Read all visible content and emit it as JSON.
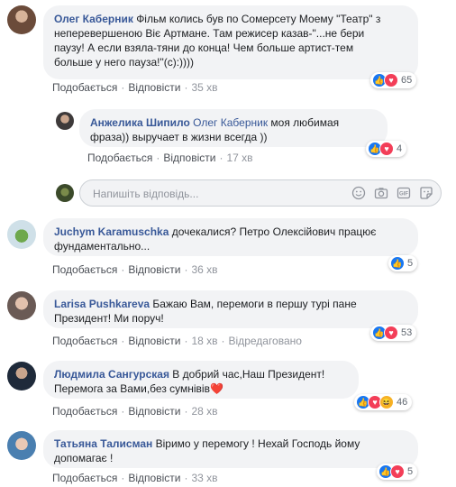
{
  "labels": {
    "like": "Подобається",
    "reply": "Відповісти",
    "edited": "Відредаговано",
    "dot": "·"
  },
  "reply_input": {
    "placeholder": "Напишіть відповідь..."
  },
  "comments": [
    {
      "author": "Олег Каберник",
      "lines": [
        "Фільм колись був по Сомерсету Моему \"Театр\" з",
        "неперевершеною Віє Артмане. Там режисер казав-\"...не бери",
        "паузу! А если взяла-тяни до конца! Чем больше артист-тем",
        "больше у него пауза!\"(с):))))"
      ],
      "time": "35 хв",
      "reactions": [
        "like",
        "love"
      ],
      "count": "65"
    },
    {
      "author": "Анжелика Шипило",
      "reply_to": "Олег Каберник",
      "lines": [
        "моя любимая",
        "фраза)) выручает в жизни всегда ))"
      ],
      "time": "17 хв",
      "reactions": [
        "like",
        "love"
      ],
      "count": "4"
    },
    {
      "author": "Juchym Karamuschka",
      "lines": [
        "дочекалися? Петро Олексійович працює",
        "фундаментально..."
      ],
      "time": "36 хв",
      "reactions": [
        "like"
      ],
      "count": "5"
    },
    {
      "author": "Larisa Pushkareva",
      "lines": [
        "Бажаю Вам, перемоги в першу турі пане",
        "Президент! Ми поруч!"
      ],
      "time": "18 хв",
      "edited": true,
      "reactions": [
        "like",
        "love"
      ],
      "count": "53"
    },
    {
      "author": "Людмила Сангурская",
      "lines": [
        "В добрий час,Наш Президент!",
        "Перемога за Вами,без сумнівів❤️"
      ],
      "time": "28 хв",
      "reactions": [
        "like",
        "love",
        "haha"
      ],
      "count": "46"
    },
    {
      "author": "Татьяна Талисман",
      "lines": [
        "Віримо у перемогу ! Нехай Господь йому",
        "допомагає !"
      ],
      "time": "33 хв",
      "reactions": [
        "like",
        "love"
      ],
      "count": "5"
    }
  ],
  "colors": {
    "link": "#385898",
    "bubble": "#f2f3f5",
    "like": "#1877f2",
    "love": "#f33e58",
    "haha": "#f7b125"
  }
}
